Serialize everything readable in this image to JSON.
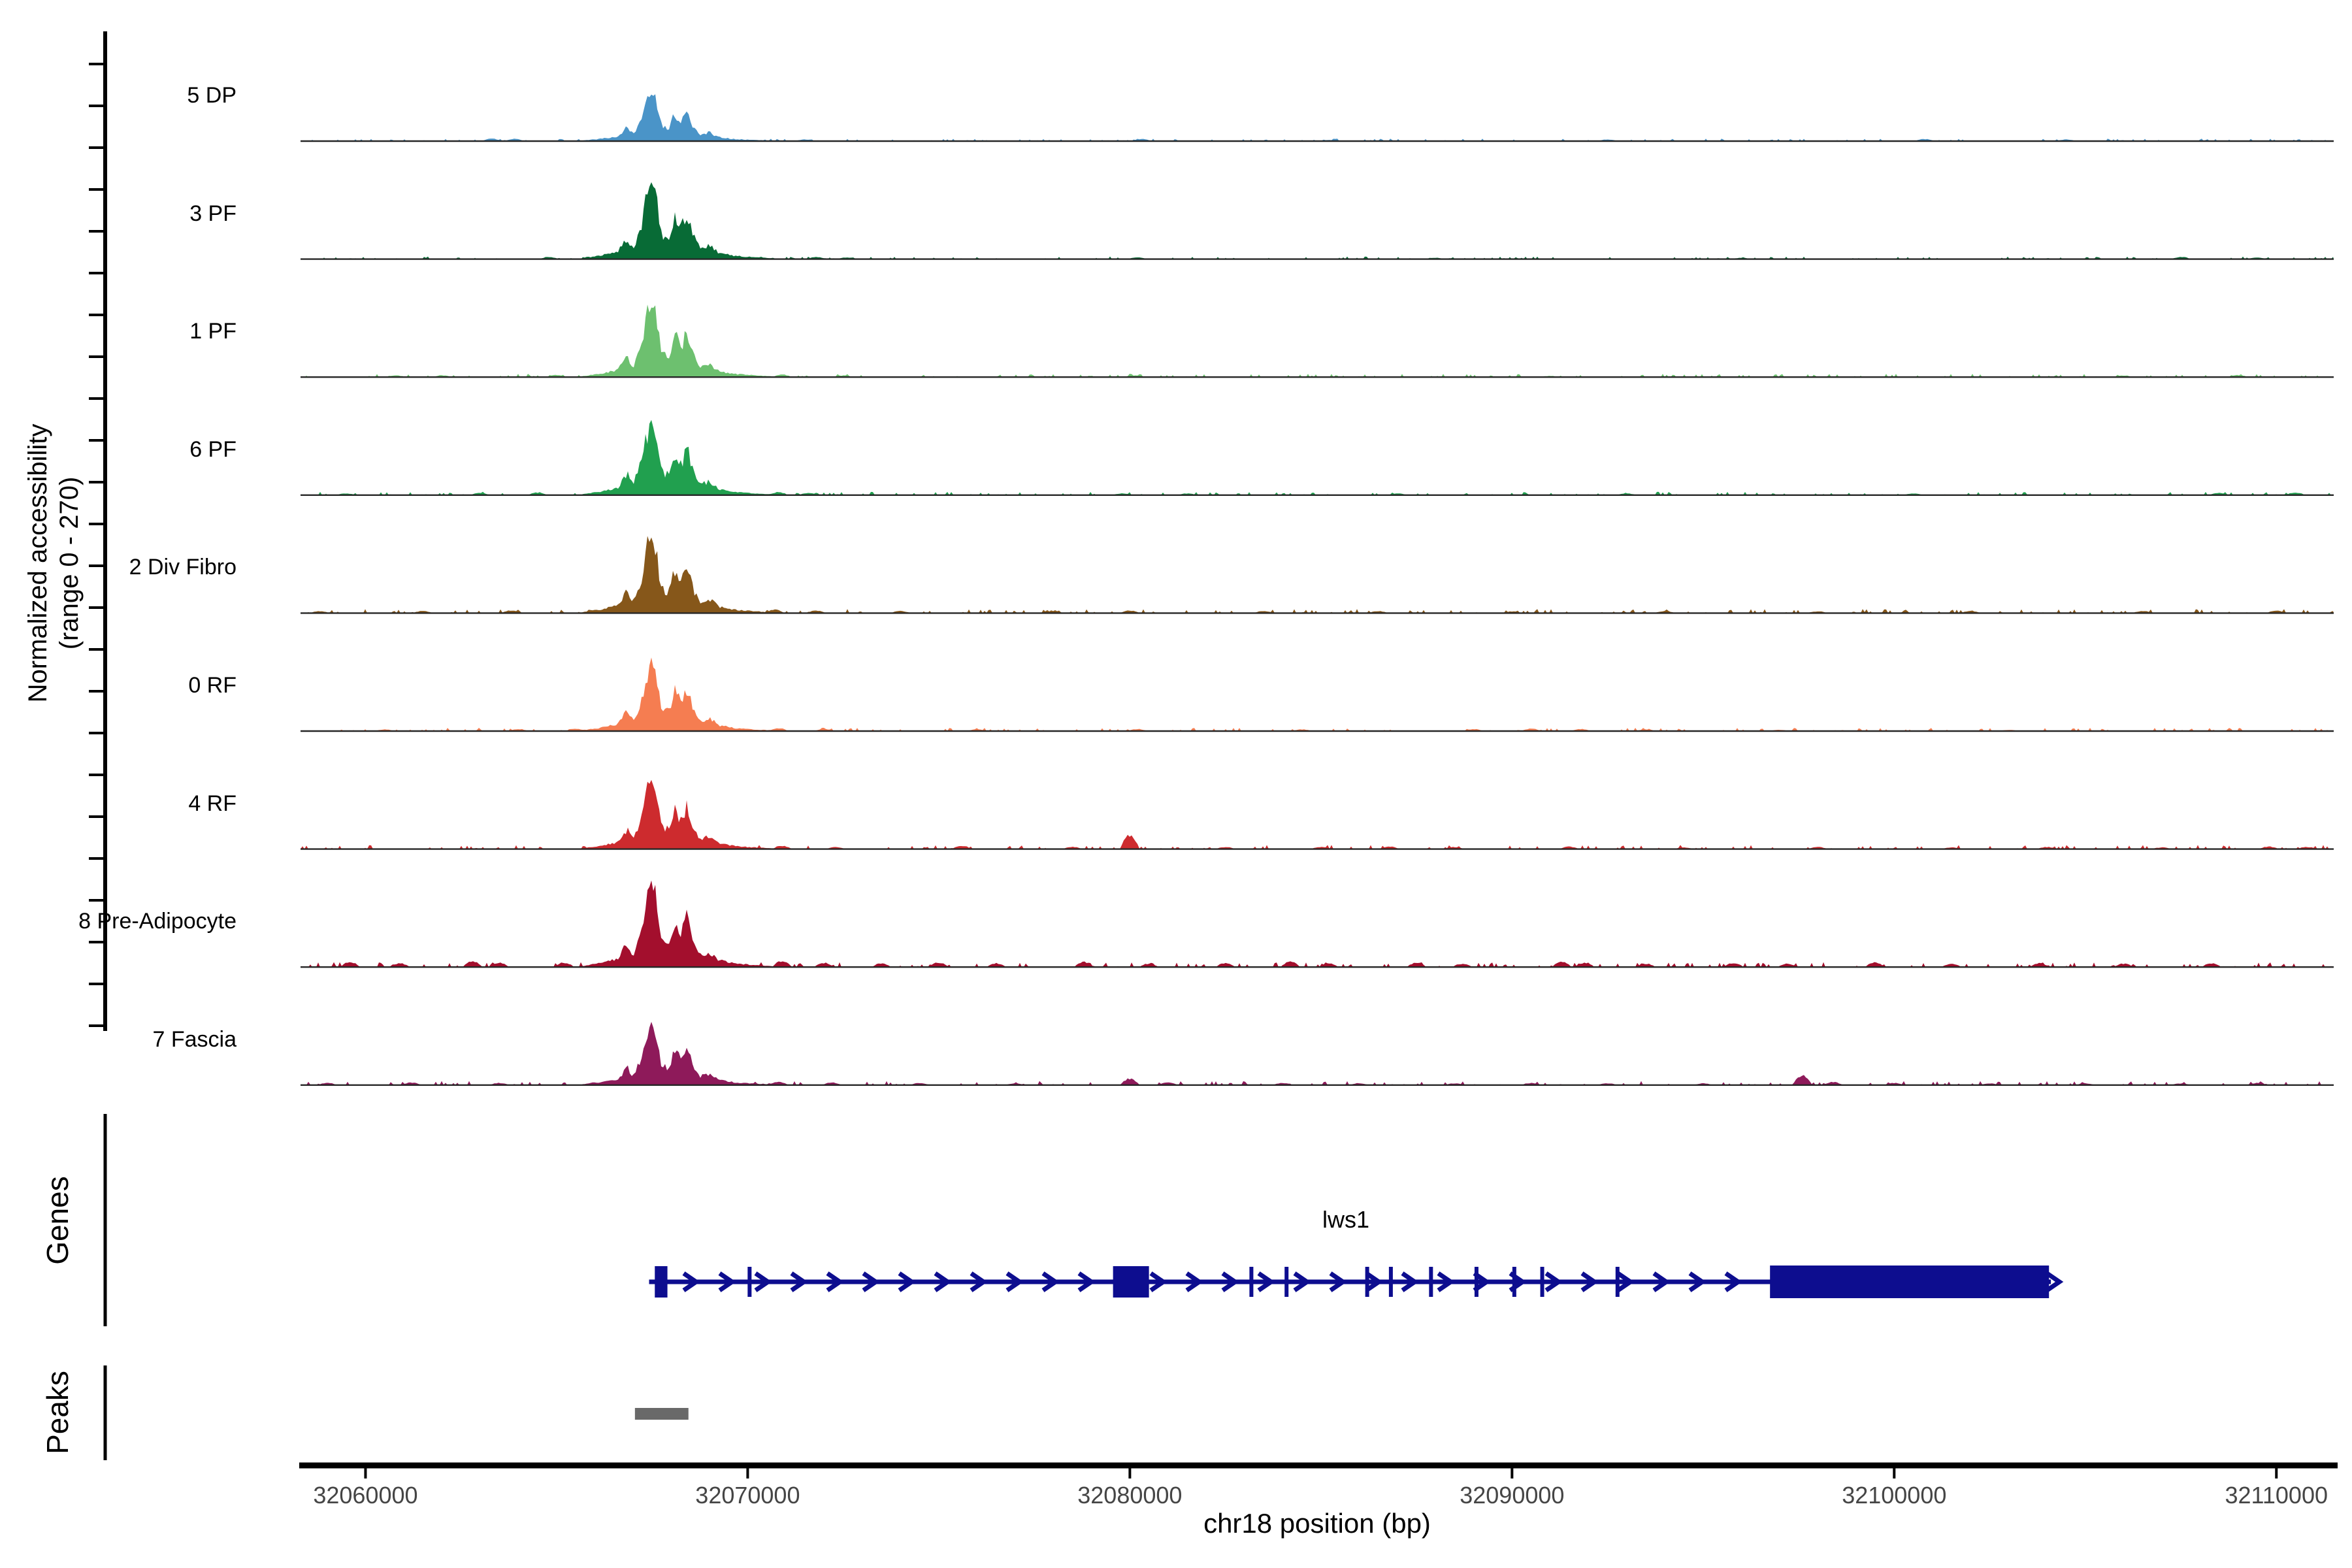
{
  "figure": {
    "y_axis_label_line1": "Normalized accessibility",
    "y_axis_label_line2": "(range 0 - 270)",
    "genes_label": "Genes",
    "peaks_label": "Peaks",
    "x_axis_title": "chr18 position (bp)"
  },
  "chart_data": {
    "type": "area",
    "subtype": "genome-coverage-tracks",
    "x_axis": {
      "label": "chr18 position (bp)",
      "chrom": "chr18",
      "xlim_bp": [
        32058300,
        32111500
      ],
      "ticks_bp": [
        32060000,
        32070000,
        32080000,
        32090000,
        32100000,
        32110000
      ]
    },
    "y_axis": {
      "label": "Normalized accessibility",
      "range_label": "(range 0 - 270)",
      "per_track_range": [
        0,
        270
      ]
    },
    "main_peak_profile": [
      [
        32065500,
        0
      ],
      [
        32066200,
        0.05
      ],
      [
        32066600,
        0.1
      ],
      [
        32066850,
        0.28
      ],
      [
        32067000,
        0.14
      ],
      [
        32067200,
        0.4
      ],
      [
        32067350,
        0.8
      ],
      [
        32067480,
        1.0
      ],
      [
        32067600,
        0.8
      ],
      [
        32067750,
        0.3
      ],
      [
        32067950,
        0.28
      ],
      [
        32068100,
        0.58
      ],
      [
        32068250,
        0.4
      ],
      [
        32068420,
        0.62
      ],
      [
        32068550,
        0.34
      ],
      [
        32068750,
        0.14
      ],
      [
        32069000,
        0.18
      ],
      [
        32069250,
        0.08
      ],
      [
        32069700,
        0.04
      ],
      [
        32070300,
        0.02
      ],
      [
        32071000,
        0
      ]
    ],
    "tracks": [
      {
        "label": "5 DP",
        "color": "#4a94c8",
        "peak_value": 118,
        "noise_amp": 1.5,
        "seed": 11,
        "bumps": [
          [
            32063300,
            6
          ],
          [
            32063900,
            5
          ],
          [
            32071500,
            4
          ],
          [
            32080300,
            5
          ],
          [
            32085200,
            3
          ],
          [
            32092500,
            4
          ],
          [
            32100800,
            5
          ],
          [
            32104500,
            4
          ]
        ]
      },
      {
        "label": "3 PF",
        "color": "#086b36",
        "peak_value": 186,
        "noise_amp": 1.6,
        "seed": 22,
        "bumps": [
          [
            32064800,
            5
          ],
          [
            32071800,
            5
          ],
          [
            32072600,
            4
          ],
          [
            32080200,
            4
          ],
          [
            32088000,
            3
          ],
          [
            32096000,
            3
          ],
          [
            32107500,
            5
          ],
          [
            32109500,
            4
          ]
        ]
      },
      {
        "label": "1 PF",
        "color": "#6dc06f",
        "peak_value": 178,
        "noise_amp": 2,
        "seed": 33,
        "bumps": [
          [
            32060800,
            4
          ],
          [
            32062000,
            4
          ],
          [
            32065000,
            5
          ],
          [
            32070900,
            6
          ],
          [
            32072500,
            4
          ],
          [
            32080100,
            4
          ],
          [
            32091000,
            3
          ],
          [
            32106000,
            4
          ],
          [
            32109000,
            5
          ]
        ]
      },
      {
        "label": "6 PF",
        "color": "#21a04f",
        "peak_value": 182,
        "noise_amp": 2,
        "seed": 44,
        "bumps": [
          [
            32059500,
            4
          ],
          [
            32063000,
            5
          ],
          [
            32064500,
            6
          ],
          [
            32070800,
            7
          ],
          [
            32071600,
            5
          ],
          [
            32079800,
            4
          ],
          [
            32081500,
            4
          ],
          [
            32087000,
            4
          ],
          [
            32093000,
            4
          ],
          [
            32100500,
            4
          ],
          [
            32108500,
            5
          ],
          [
            32110500,
            6
          ]
        ]
      },
      {
        "label": "2 Div Fibro",
        "color": "#86571a",
        "peak_value": 188,
        "noise_amp": 2.5,
        "seed": 55,
        "bumps": [
          [
            32058800,
            5
          ],
          [
            32061500,
            5
          ],
          [
            32063800,
            6
          ],
          [
            32066000,
            8
          ],
          [
            32070700,
            8
          ],
          [
            32071800,
            6
          ],
          [
            32074000,
            5
          ],
          [
            32078000,
            5
          ],
          [
            32080000,
            6
          ],
          [
            32083500,
            5
          ],
          [
            32086500,
            5
          ],
          [
            32090000,
            4
          ],
          [
            32094000,
            5
          ],
          [
            32098000,
            4
          ],
          [
            32102000,
            5
          ],
          [
            32106500,
            5
          ],
          [
            32110000,
            6
          ]
        ]
      },
      {
        "label": "0 RF",
        "color": "#f57d51",
        "peak_value": 172,
        "noise_amp": 2,
        "seed": 66,
        "bumps": [
          [
            32060500,
            4
          ],
          [
            32064000,
            5
          ],
          [
            32065500,
            6
          ],
          [
            32070800,
            7
          ],
          [
            32072000,
            5
          ],
          [
            32076000,
            4
          ],
          [
            32080200,
            5
          ],
          [
            32084500,
            4
          ],
          [
            32089000,
            5
          ],
          [
            32090500,
            6
          ],
          [
            32091800,
            5
          ],
          [
            32093500,
            4
          ],
          [
            32097000,
            3
          ],
          [
            32103000,
            3
          ]
        ]
      },
      {
        "label": "4 RF",
        "color": "#cd2b2e",
        "peak_value": 168,
        "noise_amp": 2.5,
        "seed": 77,
        "bumps": [
          [
            32070900,
            8
          ],
          [
            32072300,
            5
          ],
          [
            32075600,
            8
          ],
          [
            32078500,
            5
          ],
          [
            32080000,
            32
          ],
          [
            32082500,
            5
          ],
          [
            32085000,
            5
          ],
          [
            32086800,
            6
          ],
          [
            32088500,
            5
          ],
          [
            32091500,
            6
          ],
          [
            32094500,
            4
          ],
          [
            32098000,
            5
          ],
          [
            32101500,
            4
          ],
          [
            32104000,
            5
          ],
          [
            32107000,
            4
          ],
          [
            32109800,
            6
          ],
          [
            32110800,
            5
          ]
        ]
      },
      {
        "label": "8 Pre-Adipocyte",
        "color": "#a30f2d",
        "peak_value": 205,
        "noise_amp": 3,
        "seed": 88,
        "bumps": [
          [
            32059600,
            12
          ],
          [
            32060900,
            9
          ],
          [
            32062800,
            13
          ],
          [
            32063500,
            10
          ],
          [
            32065200,
            10
          ],
          [
            32066200,
            12
          ],
          [
            32070900,
            14
          ],
          [
            32072000,
            10
          ],
          [
            32073500,
            9
          ],
          [
            32075000,
            11
          ],
          [
            32076500,
            9
          ],
          [
            32078800,
            12
          ],
          [
            32080500,
            8
          ],
          [
            32082500,
            10
          ],
          [
            32084200,
            13
          ],
          [
            32085200,
            9
          ],
          [
            32087500,
            10
          ],
          [
            32088700,
            8
          ],
          [
            32091300,
            12
          ],
          [
            32091900,
            10
          ],
          [
            32093500,
            8
          ],
          [
            32095800,
            10
          ],
          [
            32097200,
            8
          ],
          [
            32099500,
            11
          ],
          [
            32101500,
            8
          ],
          [
            32103800,
            9
          ],
          [
            32106000,
            8
          ],
          [
            32108300,
            9
          ]
        ]
      },
      {
        "label": "7 Fascia",
        "color": "#8e1a5a",
        "peak_value": 150,
        "noise_amp": 2.5,
        "seed": 99,
        "bumps": [
          [
            32059000,
            5
          ],
          [
            32061200,
            6
          ],
          [
            32063500,
            5
          ],
          [
            32066000,
            6
          ],
          [
            32070800,
            8
          ],
          [
            32072200,
            6
          ],
          [
            32074500,
            5
          ],
          [
            32077000,
            4
          ],
          [
            32080000,
            15
          ],
          [
            32081000,
            6
          ],
          [
            32084000,
            5
          ],
          [
            32086000,
            4
          ],
          [
            32088500,
            4
          ],
          [
            32090500,
            5
          ],
          [
            32092500,
            4
          ],
          [
            32095000,
            4
          ],
          [
            32097600,
            22
          ],
          [
            32098400,
            7
          ],
          [
            32100000,
            5
          ],
          [
            32102500,
            4
          ],
          [
            32105000,
            4
          ],
          [
            32107500,
            4
          ],
          [
            32109500,
            5
          ]
        ]
      }
    ],
    "gene": {
      "name": "lws1",
      "strand": "+",
      "line_start_bp": 32067420,
      "line_end_bp": 32104100,
      "thin_exon_width_bp": 100,
      "thin_exons_bp": [
        32070050,
        32083180,
        32084100,
        32086210,
        32086830,
        32087880,
        32089070,
        32090060,
        32090790,
        32092760
      ],
      "box_exons_bp": [
        [
          32067570,
          32067900
        ],
        [
          32079560,
          32080500
        ],
        [
          32096750,
          32104050
        ]
      ],
      "color": "#0d0d8f"
    },
    "peaks_track": {
      "color": "#696969",
      "regions_bp": [
        [
          32067050,
          32068450
        ]
      ]
    }
  }
}
